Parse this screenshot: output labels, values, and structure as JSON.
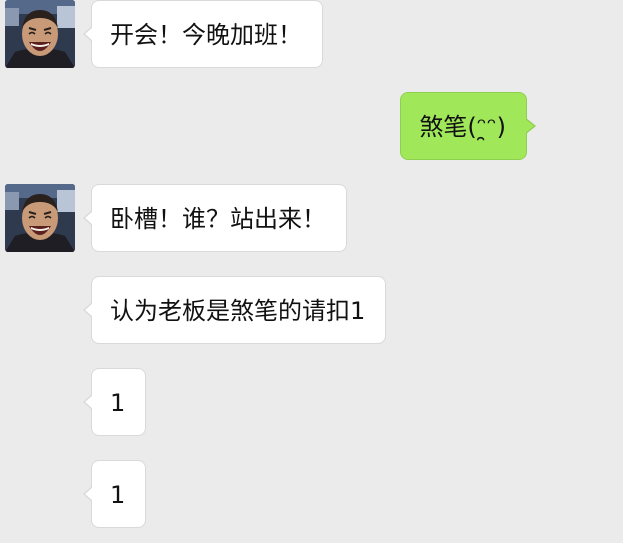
{
  "colors": {
    "background": "#ebebeb",
    "incoming_bubble": "#ffffff",
    "outgoing_bubble": "#a0e75a",
    "text": "#111111"
  },
  "messages": [
    {
      "direction": "incoming",
      "text": "开会！今晚加班！",
      "has_avatar": true,
      "avatar_icon": "laughing-man-avatar"
    },
    {
      "direction": "outgoing",
      "text": "煞笔(ᵔ̯ᵔ)",
      "has_avatar": false
    },
    {
      "direction": "incoming",
      "text": "卧槽！谁？站出来！",
      "has_avatar": true,
      "avatar_icon": "laughing-man-avatar"
    },
    {
      "direction": "incoming",
      "text": "认为老板是煞笔的请扣1",
      "has_avatar": false
    },
    {
      "direction": "incoming",
      "text": "1",
      "has_avatar": false
    },
    {
      "direction": "incoming",
      "text": "1",
      "has_avatar": false
    }
  ]
}
